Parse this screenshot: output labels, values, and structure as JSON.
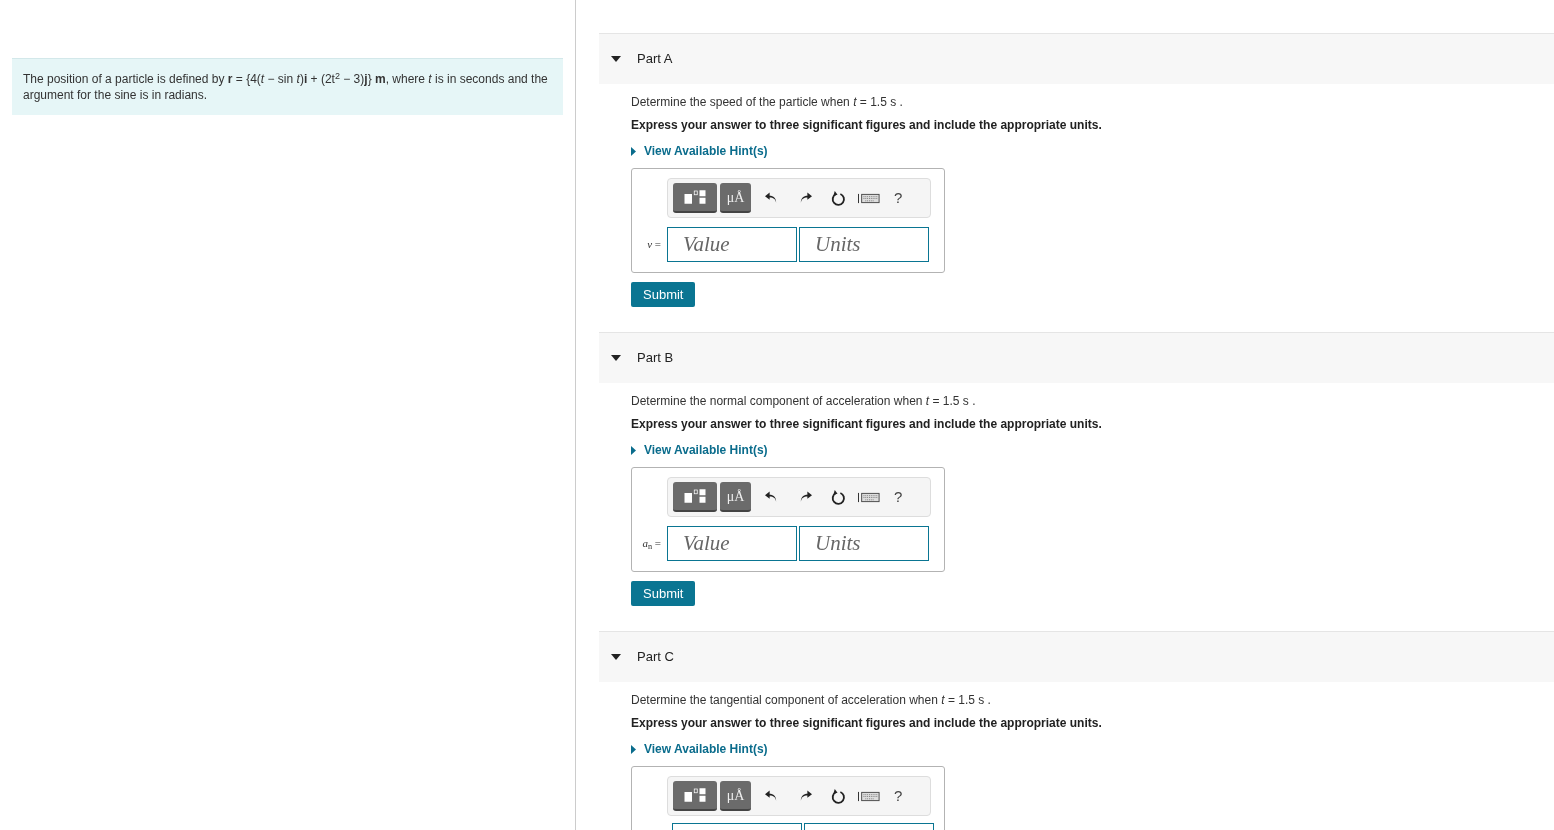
{
  "problem": {
    "text": "The position of a particle is defined by **r** = {4(*t* − sin *t*)**i** + (2t$^{2}$ − 3)**j**} **m**, where *t* is in seconds and the argument for the sine is in radians."
  },
  "parts": [
    {
      "title": "Part A",
      "expanded": true,
      "question": "Determine the speed of the particle when *t* = 1.5 s .",
      "instruction": "Express your answer to three significant figures and include the appropriate units.",
      "hint_link": "View Available Hint(s)",
      "toolbar": {
        "units_button": "μÅ",
        "help": "?"
      },
      "variable": "*v* =",
      "value_placeholder": "Value",
      "units_placeholder": "Units",
      "submit": "Submit"
    },
    {
      "title": "Part B",
      "expanded": true,
      "question": "Determine the normal component of acceleration when *t* = 1.5 s .",
      "instruction": "Express your answer to three significant figures and include the appropriate units.",
      "hint_link": "View Available Hint(s)",
      "toolbar": {
        "units_button": "μÅ",
        "help": "?"
      },
      "variable": "*a*$_{n}$ =",
      "value_placeholder": "Value",
      "units_placeholder": "Units",
      "submit": "Submit"
    },
    {
      "title": "Part C",
      "expanded": true,
      "question": "Determine the tangential component of acceleration when *t* = 1.5 s .",
      "instruction": "Express your answer to three significant figures and include the appropriate units.",
      "hint_link": "View Available Hint(s)",
      "toolbar": {
        "units_button": "μÅ",
        "help": "?"
      }
    }
  ]
}
